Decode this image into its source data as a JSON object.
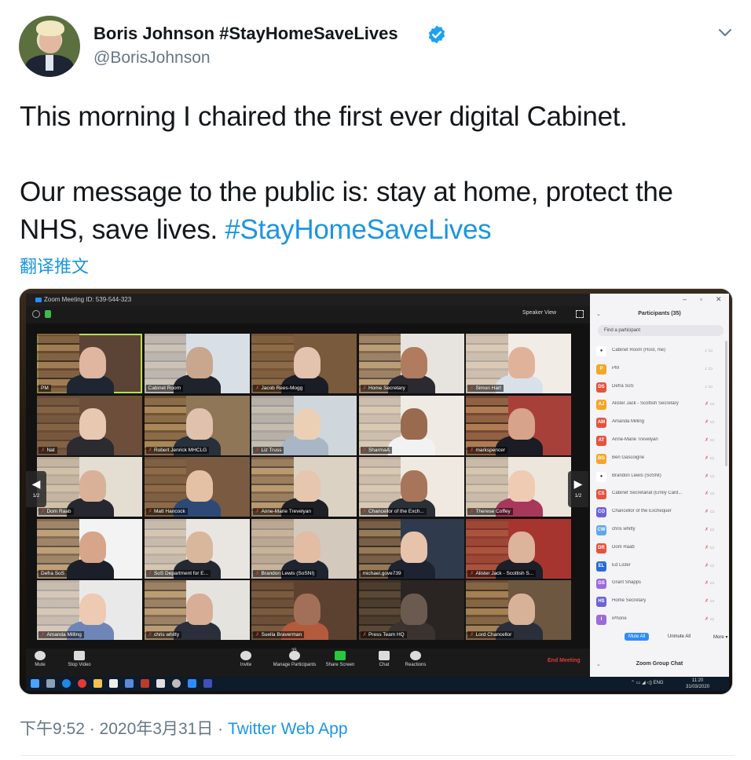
{
  "author": {
    "display_name": "Boris Johnson #StayHomeSaveLives",
    "handle": "@BorisJohnson",
    "verified": true
  },
  "tweet": {
    "line1": "This morning I chaired the first ever digital Cabinet.",
    "line2": "Our message to the public is: stay at home, protect the",
    "line3_prefix": "NHS, save lives. ",
    "hashtag": "#StayHomeSaveLives",
    "translate_label": "翻译推文"
  },
  "footer": {
    "time": "下午9:52",
    "separator": " · ",
    "date": "2020年3月31日",
    "source": "Twitter Web App"
  },
  "zoom": {
    "title": "Zoom Meeting ID: 539-544-323",
    "speaker_view": "Speaker View",
    "page_left": "1/2",
    "page_right": "1/2",
    "tiles": [
      {
        "label": "PM",
        "muted": false,
        "active": true,
        "bg": "#5b4436",
        "skin": "#e0b6a0",
        "shirt": "#1e2633"
      },
      {
        "label": "Cabinet Room",
        "muted": false,
        "active": false,
        "bg": "#d9dfe6",
        "skin": "#c9a68e",
        "shirt": "#1f232b"
      },
      {
        "label": "Jacob Rees-Mogg",
        "muted": true,
        "active": false,
        "bg": "#7a5a3c",
        "skin": "#e3c3ad",
        "shirt": "#1a1d25"
      },
      {
        "label": "Home Secretary",
        "muted": true,
        "active": false,
        "bg": "#e7e4df",
        "skin": "#b07b5f",
        "shirt": "#2a2a30"
      },
      {
        "label": "Simon Hart",
        "muted": true,
        "active": false,
        "bg": "#f1ece6",
        "skin": "#e1b29a",
        "shirt": "#d8e1ea"
      },
      {
        "label": "Nat",
        "muted": true,
        "active": false,
        "bg": "#6c4e3a",
        "skin": "#e8c8b1",
        "shirt": "#2b2b30"
      },
      {
        "label": "Robert Jenrick MHCLG",
        "muted": true,
        "active": false,
        "bg": "#8f7656",
        "skin": "#e0c1ad",
        "shirt": "#28303c"
      },
      {
        "label": "Liz Truss",
        "muted": true,
        "active": false,
        "bg": "#cfd6dc",
        "skin": "#ecd0b6",
        "shirt": "#a8b6c5"
      },
      {
        "label": "SharmaA",
        "muted": true,
        "active": false,
        "bg": "#efeae3",
        "skin": "#9a6a4f",
        "shirt": "#f2f2f2"
      },
      {
        "label": "markspencer",
        "muted": true,
        "active": false,
        "bg": "#a8403a",
        "skin": "#d7a38a",
        "shirt": "#1c1c24"
      },
      {
        "label": "Dom Raab",
        "muted": true,
        "active": false,
        "bg": "#e3ddd2",
        "skin": "#d9b199",
        "shirt": "#26272f"
      },
      {
        "label": "Matt Hancock",
        "muted": true,
        "active": false,
        "bg": "#7a5a40",
        "skin": "#e4c0a5",
        "shirt": "#2d4a76"
      },
      {
        "label": "Anne-Marie Trevelyan",
        "muted": true,
        "active": false,
        "bg": "#dcd2c4",
        "skin": "#e6c6ae",
        "shirt": "#1f1f26"
      },
      {
        "label": "Chancellor of the Exch...",
        "muted": true,
        "active": false,
        "bg": "#efe9e1",
        "skin": "#a77559",
        "shirt": "#2a2f38"
      },
      {
        "label": "Therese Coffey",
        "muted": true,
        "active": false,
        "bg": "#ece6dd",
        "skin": "#efcbb4",
        "shirt": "#a8385b"
      },
      {
        "label": "Defra SoS",
        "muted": false,
        "active": false,
        "bg": "#f3f3f3",
        "skin": "#d7a58a",
        "shirt": "#1b1f2a"
      },
      {
        "label": "SoS Department for E...",
        "muted": true,
        "active": false,
        "bg": "#e9e6e2",
        "skin": "#d9b79d",
        "shirt": "#232833"
      },
      {
        "label": "Brandon Lewis (SoSNI)",
        "muted": true,
        "active": false,
        "bg": "#d3c9bd",
        "skin": "#e2bca3",
        "shirt": "#1e2430"
      },
      {
        "label": "michael.gove739",
        "muted": false,
        "active": false,
        "bg": "#2f3a4d",
        "skin": "#e6c3aa",
        "shirt": "#1d2330"
      },
      {
        "label": "Alister Jack - Scottish S...",
        "muted": true,
        "active": false,
        "bg": "#a7352f",
        "skin": "#dcb39b",
        "shirt": "#1c1e28"
      },
      {
        "label": "Amanda Milling",
        "muted": true,
        "active": false,
        "bg": "#eae9ea",
        "skin": "#eecab3",
        "shirt": "#6e86b7"
      },
      {
        "label": "chris whitty",
        "muted": true,
        "active": false,
        "bg": "#e5e3dd",
        "skin": "#d8ae96",
        "shirt": "#2a2f3b"
      },
      {
        "label": "Suella Braverman",
        "muted": true,
        "active": false,
        "bg": "#5d4130",
        "skin": "#a27058",
        "shirt": "#b45a3d"
      },
      {
        "label": "Press Team HQ",
        "muted": true,
        "active": false,
        "bg": "#2a2522",
        "skin": "#6b5a50",
        "shirt": "#3a3330"
      },
      {
        "label": "Lord Chancellor",
        "muted": true,
        "active": false,
        "bg": "#6e5740",
        "skin": "#d8b199",
        "shirt": "#2a2f3a"
      }
    ],
    "toolbar": {
      "mute": "Mute",
      "stop_video": "Stop Video",
      "invite": "Invite",
      "manage_participants": "Manage Participants",
      "participant_count": "35",
      "share_screen": "Share Screen",
      "chat": "Chat",
      "reactions": "Reactions",
      "end_meeting": "End Meeting"
    },
    "panel": {
      "title": "Participants (35)",
      "search_placeholder": "Find a participant",
      "participants": [
        {
          "initials": "",
          "name": "Cabinet Room (Host, me)",
          "color": "#ffffff",
          "muted": false
        },
        {
          "initials": "P",
          "name": "PM",
          "color": "#f5a623",
          "muted": false
        },
        {
          "initials": "DS",
          "name": "Defra SoS",
          "color": "#e5533d",
          "muted": false
        },
        {
          "initials": "AJ",
          "name": "Alister Jack - Scottish Secretary",
          "color": "#f5a623",
          "muted": true
        },
        {
          "initials": "AM",
          "name": "Amanda Milling",
          "color": "#e5533d",
          "muted": true
        },
        {
          "initials": "AT",
          "name": "Anne-Marie Trevelyan",
          "color": "#e5533d",
          "muted": true
        },
        {
          "initials": "BG",
          "name": "Ben Gascoigne",
          "color": "#f5a623",
          "muted": true
        },
        {
          "initials": "",
          "name": "Brandon Lewis (SoSNI)",
          "color": "#ffffff",
          "muted": true
        },
        {
          "initials": "CS",
          "name": "Cabinet Secretariat (Emily Card...",
          "color": "#e5533d",
          "muted": true
        },
        {
          "initials": "CO",
          "name": "Chancellor of the Exchequer",
          "color": "#6c63d9",
          "muted": true
        },
        {
          "initials": "CW",
          "name": "chris whitty",
          "color": "#5fa8e8",
          "muted": true
        },
        {
          "initials": "DR",
          "name": "Dom Raab",
          "color": "#e5533d",
          "muted": true
        },
        {
          "initials": "EL",
          "name": "Ed Lister",
          "color": "#2d6ad9",
          "muted": true
        },
        {
          "initials": "GS",
          "name": "Grant Shapps",
          "color": "#9b6cd9",
          "muted": true
        },
        {
          "initials": "HS",
          "name": "Home Secretary",
          "color": "#6c63d9",
          "muted": true
        },
        {
          "initials": "I",
          "name": "iPhone",
          "color": "#9b6cd9",
          "muted": true
        }
      ],
      "mute_all": "Mute All",
      "unmute_all": "Unmute All",
      "more": "More ▾",
      "chat_title": "Zoom Group Chat"
    },
    "taskbar": {
      "lang": "ENG",
      "time": "11:20",
      "date": "31/03/2020"
    }
  },
  "colors": {
    "link": "#1b95e0",
    "secondary_text": "#657786",
    "verified": "#1da1f2",
    "zoom_blue": "#2d8cff",
    "end_meeting": "#e03b3b"
  },
  "icons": [
    "verified-badge-icon",
    "chevron-down-icon",
    "mute-icon",
    "video-icon",
    "invite-icon",
    "participants-icon",
    "share-screen-icon",
    "chat-icon",
    "reactions-icon"
  ]
}
